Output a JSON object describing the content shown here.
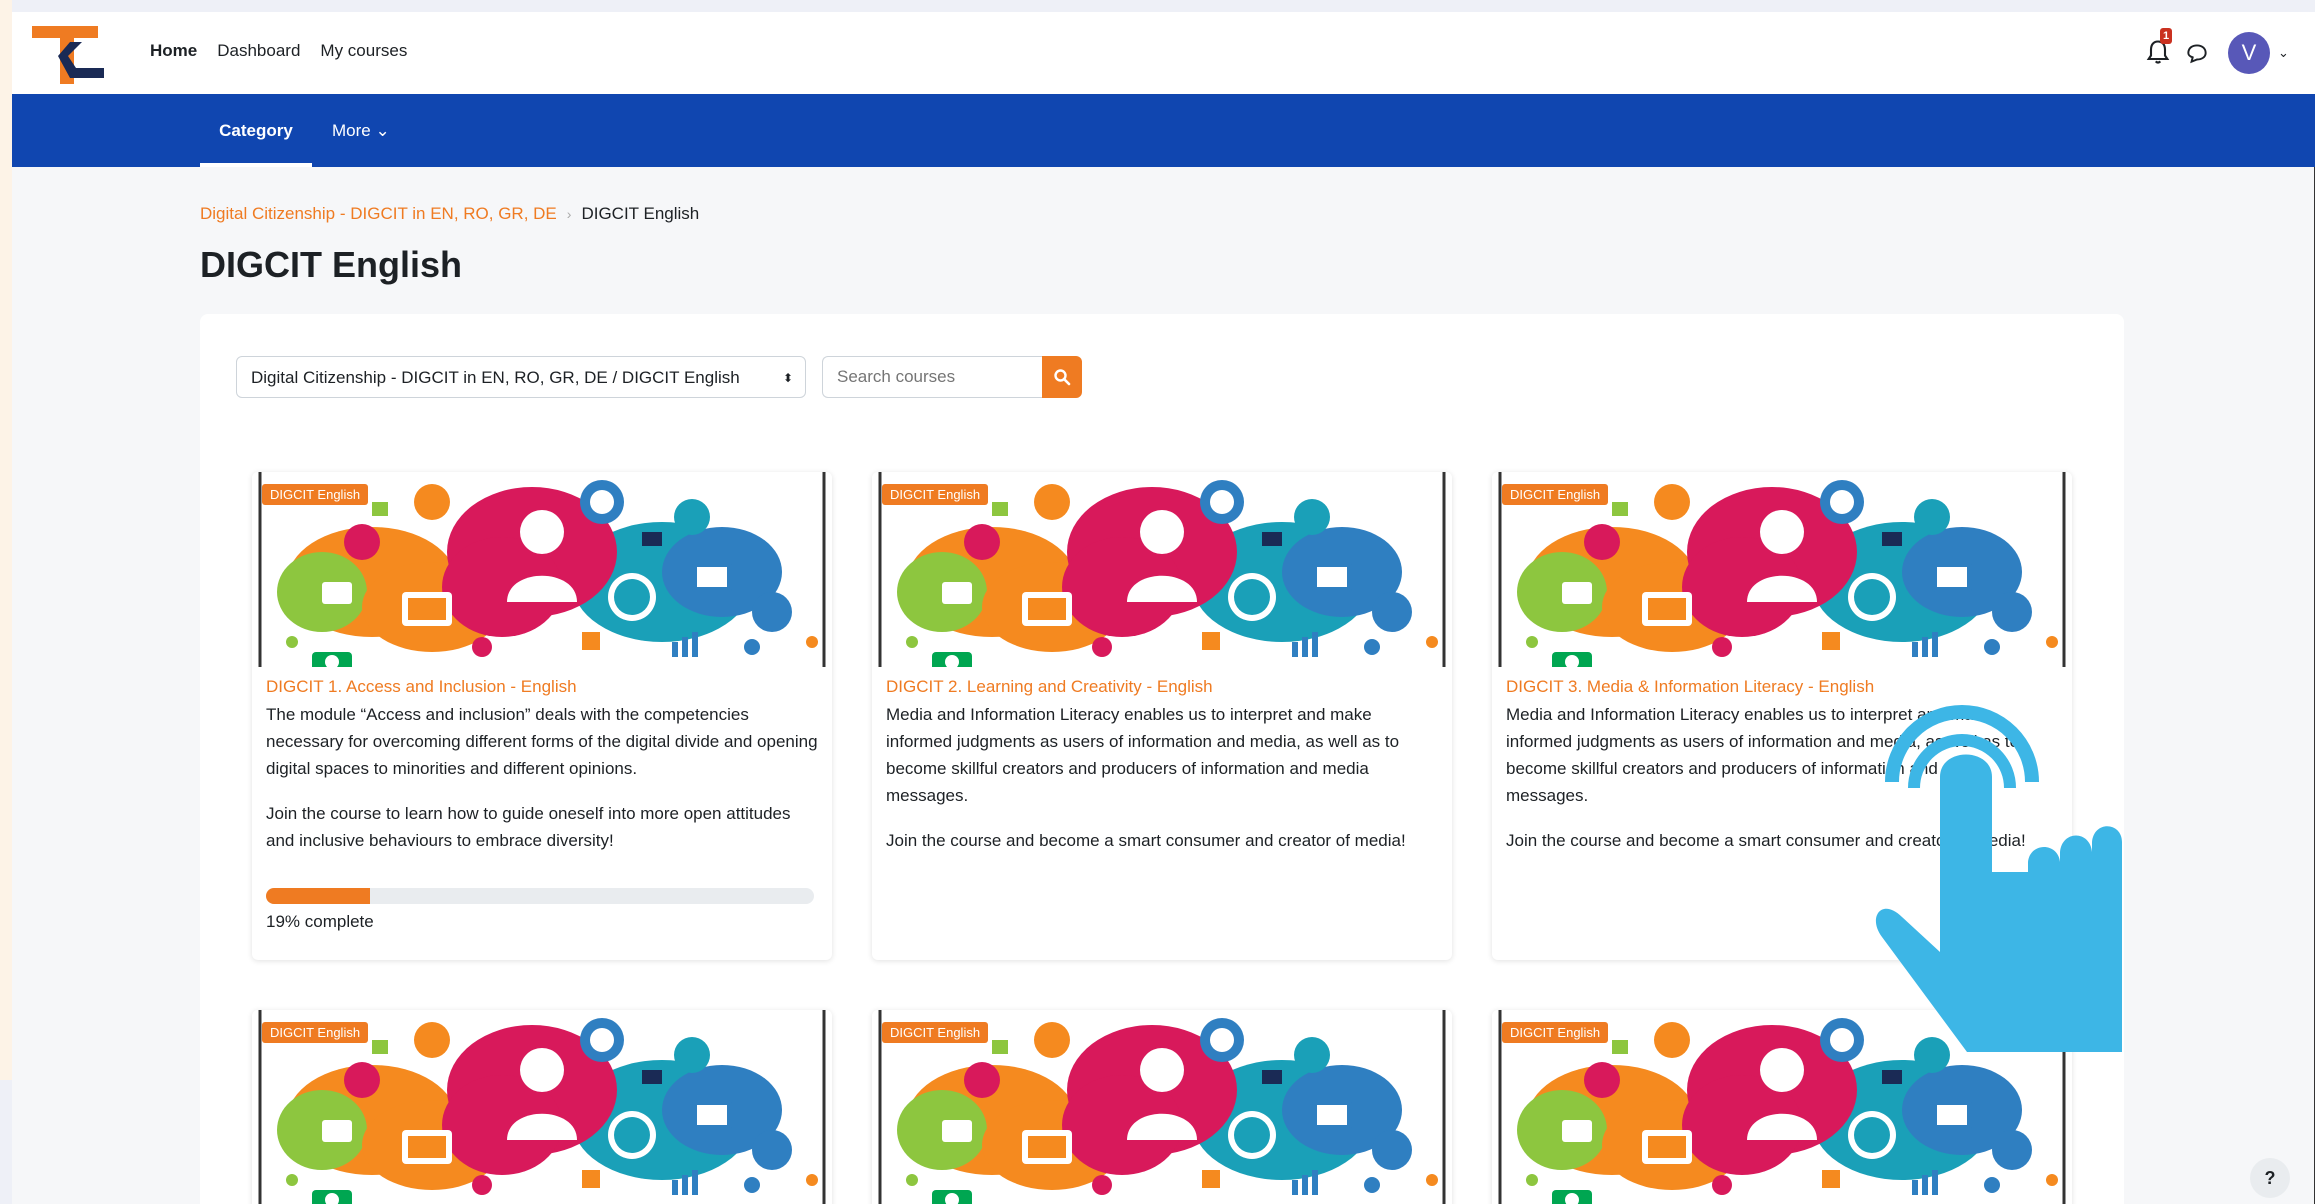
{
  "nav": {
    "home": "Home",
    "dashboard": "Dashboard",
    "my_courses": "My courses",
    "notification_count": "1",
    "avatar_initial": "V",
    "chevron": "⌄"
  },
  "secondary_nav": {
    "category": "Category",
    "more": "More ⌄"
  },
  "breadcrumb": {
    "parent": "Digital Citizenship - DIGCIT in EN, RO, GR, DE",
    "separator": "›",
    "current": "DIGCIT English"
  },
  "page_title": "DIGCIT English",
  "filters": {
    "category_value": "Digital Citizenship - DIGCIT in EN, RO, GR, DE / DIGCIT English",
    "search_placeholder": "Search courses"
  },
  "courses": [
    {
      "tag": "DIGCIT English",
      "title": "DIGCIT 1. Access and Inclusion - English",
      "description": "The module “Access and inclusion” deals with the competencies necessary for overcoming different forms of the digital divide and opening digital spaces to minorities and different opinions.",
      "join": "Join the course to learn how to guide oneself into more open attitudes and inclusive behaviours to embrace diversity!",
      "progress": 19,
      "progress_text": "19% complete"
    },
    {
      "tag": "DIGCIT English",
      "title": "DIGCIT 2. Learning and Creativity - English",
      "description": "Media and Information Literacy enables us to interpret and make informed judgments as users of information and media, as well as to become skillful creators and producers of information and media messages.",
      "join": "Join the course and become a smart consumer and creator of media!"
    },
    {
      "tag": "DIGCIT English",
      "title": "DIGCIT 3. Media & Information Literacy - English",
      "description": "Media and Information Literacy enables us to interpret and make informed judgments as users of information and media, as well as to become skillful creators and producers of information and media messages.",
      "join": "Join the course and become a smart consumer and creator of media!"
    },
    {
      "tag": "DIGCIT English"
    },
    {
      "tag": "DIGCIT English"
    },
    {
      "tag": "DIGCIT English"
    }
  ],
  "help_label": "?",
  "colors": {
    "accent": "#ef7b22",
    "navbar": "#1046b0",
    "hand": "#3db6e6"
  },
  "icons": [
    "logo-icon",
    "bell-icon",
    "chat-icon",
    "search-icon",
    "pointer-hand-icon",
    "help-icon"
  ]
}
